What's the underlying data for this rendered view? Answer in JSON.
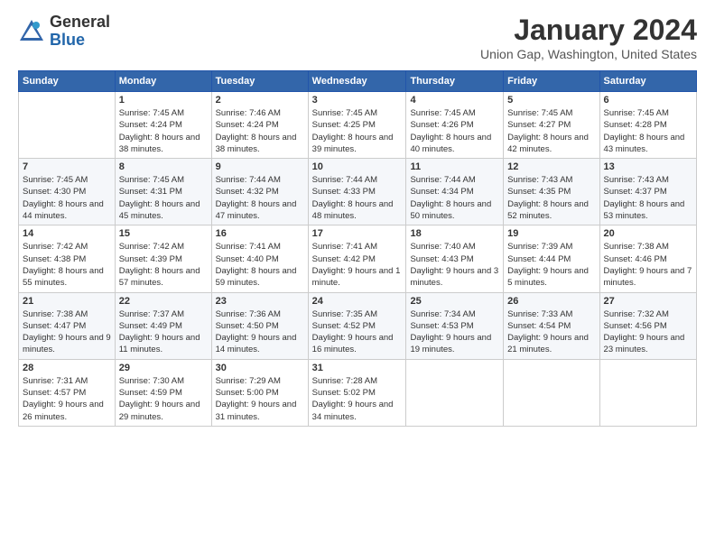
{
  "header": {
    "logo_general": "General",
    "logo_blue": "Blue",
    "month_title": "January 2024",
    "location": "Union Gap, Washington, United States"
  },
  "days_of_week": [
    "Sunday",
    "Monday",
    "Tuesday",
    "Wednesday",
    "Thursday",
    "Friday",
    "Saturday"
  ],
  "weeks": [
    [
      {
        "day": "",
        "sunrise": "",
        "sunset": "",
        "daylight": ""
      },
      {
        "day": "1",
        "sunrise": "Sunrise: 7:45 AM",
        "sunset": "Sunset: 4:24 PM",
        "daylight": "Daylight: 8 hours and 38 minutes."
      },
      {
        "day": "2",
        "sunrise": "Sunrise: 7:46 AM",
        "sunset": "Sunset: 4:24 PM",
        "daylight": "Daylight: 8 hours and 38 minutes."
      },
      {
        "day": "3",
        "sunrise": "Sunrise: 7:45 AM",
        "sunset": "Sunset: 4:25 PM",
        "daylight": "Daylight: 8 hours and 39 minutes."
      },
      {
        "day": "4",
        "sunrise": "Sunrise: 7:45 AM",
        "sunset": "Sunset: 4:26 PM",
        "daylight": "Daylight: 8 hours and 40 minutes."
      },
      {
        "day": "5",
        "sunrise": "Sunrise: 7:45 AM",
        "sunset": "Sunset: 4:27 PM",
        "daylight": "Daylight: 8 hours and 42 minutes."
      },
      {
        "day": "6",
        "sunrise": "Sunrise: 7:45 AM",
        "sunset": "Sunset: 4:28 PM",
        "daylight": "Daylight: 8 hours and 43 minutes."
      }
    ],
    [
      {
        "day": "7",
        "sunrise": "Sunrise: 7:45 AM",
        "sunset": "Sunset: 4:30 PM",
        "daylight": "Daylight: 8 hours and 44 minutes."
      },
      {
        "day": "8",
        "sunrise": "Sunrise: 7:45 AM",
        "sunset": "Sunset: 4:31 PM",
        "daylight": "Daylight: 8 hours and 45 minutes."
      },
      {
        "day": "9",
        "sunrise": "Sunrise: 7:44 AM",
        "sunset": "Sunset: 4:32 PM",
        "daylight": "Daylight: 8 hours and 47 minutes."
      },
      {
        "day": "10",
        "sunrise": "Sunrise: 7:44 AM",
        "sunset": "Sunset: 4:33 PM",
        "daylight": "Daylight: 8 hours and 48 minutes."
      },
      {
        "day": "11",
        "sunrise": "Sunrise: 7:44 AM",
        "sunset": "Sunset: 4:34 PM",
        "daylight": "Daylight: 8 hours and 50 minutes."
      },
      {
        "day": "12",
        "sunrise": "Sunrise: 7:43 AM",
        "sunset": "Sunset: 4:35 PM",
        "daylight": "Daylight: 8 hours and 52 minutes."
      },
      {
        "day": "13",
        "sunrise": "Sunrise: 7:43 AM",
        "sunset": "Sunset: 4:37 PM",
        "daylight": "Daylight: 8 hours and 53 minutes."
      }
    ],
    [
      {
        "day": "14",
        "sunrise": "Sunrise: 7:42 AM",
        "sunset": "Sunset: 4:38 PM",
        "daylight": "Daylight: 8 hours and 55 minutes."
      },
      {
        "day": "15",
        "sunrise": "Sunrise: 7:42 AM",
        "sunset": "Sunset: 4:39 PM",
        "daylight": "Daylight: 8 hours and 57 minutes."
      },
      {
        "day": "16",
        "sunrise": "Sunrise: 7:41 AM",
        "sunset": "Sunset: 4:40 PM",
        "daylight": "Daylight: 8 hours and 59 minutes."
      },
      {
        "day": "17",
        "sunrise": "Sunrise: 7:41 AM",
        "sunset": "Sunset: 4:42 PM",
        "daylight": "Daylight: 9 hours and 1 minute."
      },
      {
        "day": "18",
        "sunrise": "Sunrise: 7:40 AM",
        "sunset": "Sunset: 4:43 PM",
        "daylight": "Daylight: 9 hours and 3 minutes."
      },
      {
        "day": "19",
        "sunrise": "Sunrise: 7:39 AM",
        "sunset": "Sunset: 4:44 PM",
        "daylight": "Daylight: 9 hours and 5 minutes."
      },
      {
        "day": "20",
        "sunrise": "Sunrise: 7:38 AM",
        "sunset": "Sunset: 4:46 PM",
        "daylight": "Daylight: 9 hours and 7 minutes."
      }
    ],
    [
      {
        "day": "21",
        "sunrise": "Sunrise: 7:38 AM",
        "sunset": "Sunset: 4:47 PM",
        "daylight": "Daylight: 9 hours and 9 minutes."
      },
      {
        "day": "22",
        "sunrise": "Sunrise: 7:37 AM",
        "sunset": "Sunset: 4:49 PM",
        "daylight": "Daylight: 9 hours and 11 minutes."
      },
      {
        "day": "23",
        "sunrise": "Sunrise: 7:36 AM",
        "sunset": "Sunset: 4:50 PM",
        "daylight": "Daylight: 9 hours and 14 minutes."
      },
      {
        "day": "24",
        "sunrise": "Sunrise: 7:35 AM",
        "sunset": "Sunset: 4:52 PM",
        "daylight": "Daylight: 9 hours and 16 minutes."
      },
      {
        "day": "25",
        "sunrise": "Sunrise: 7:34 AM",
        "sunset": "Sunset: 4:53 PM",
        "daylight": "Daylight: 9 hours and 19 minutes."
      },
      {
        "day": "26",
        "sunrise": "Sunrise: 7:33 AM",
        "sunset": "Sunset: 4:54 PM",
        "daylight": "Daylight: 9 hours and 21 minutes."
      },
      {
        "day": "27",
        "sunrise": "Sunrise: 7:32 AM",
        "sunset": "Sunset: 4:56 PM",
        "daylight": "Daylight: 9 hours and 23 minutes."
      }
    ],
    [
      {
        "day": "28",
        "sunrise": "Sunrise: 7:31 AM",
        "sunset": "Sunset: 4:57 PM",
        "daylight": "Daylight: 9 hours and 26 minutes."
      },
      {
        "day": "29",
        "sunrise": "Sunrise: 7:30 AM",
        "sunset": "Sunset: 4:59 PM",
        "daylight": "Daylight: 9 hours and 29 minutes."
      },
      {
        "day": "30",
        "sunrise": "Sunrise: 7:29 AM",
        "sunset": "Sunset: 5:00 PM",
        "daylight": "Daylight: 9 hours and 31 minutes."
      },
      {
        "day": "31",
        "sunrise": "Sunrise: 7:28 AM",
        "sunset": "Sunset: 5:02 PM",
        "daylight": "Daylight: 9 hours and 34 minutes."
      },
      {
        "day": "",
        "sunrise": "",
        "sunset": "",
        "daylight": ""
      },
      {
        "day": "",
        "sunrise": "",
        "sunset": "",
        "daylight": ""
      },
      {
        "day": "",
        "sunrise": "",
        "sunset": "",
        "daylight": ""
      }
    ]
  ]
}
